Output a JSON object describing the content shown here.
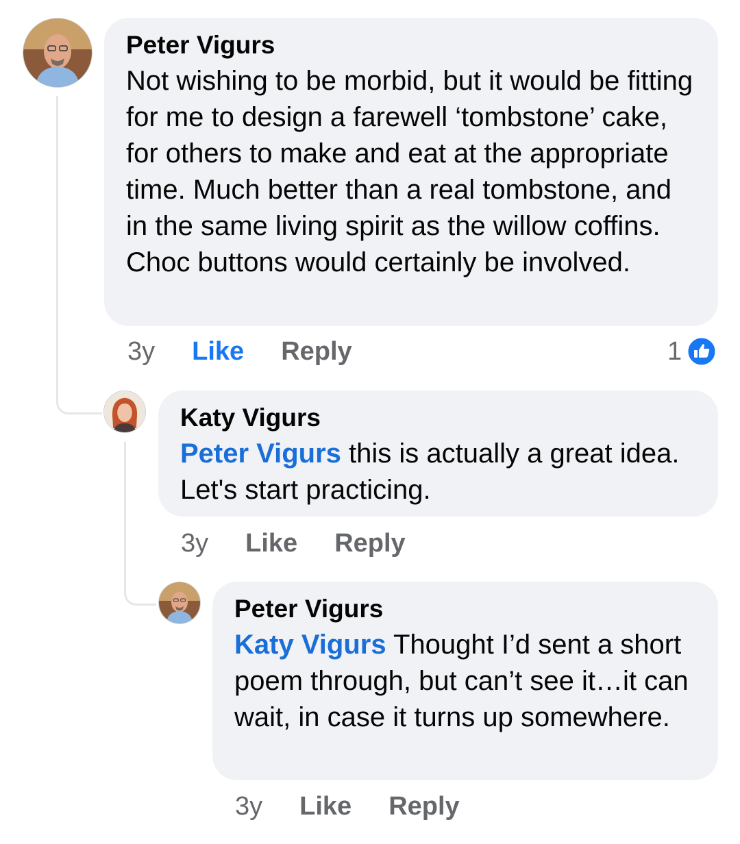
{
  "comments": [
    {
      "author": "Peter Vigurs",
      "text": "Not wishing to be morbid, but it would be fitting for me to design a farewell ‘tombstone’ cake, for others to make and eat at the appropriate time.  Much better than a real tombstone, and in the same living spirit as the willow coffins.  Choc buttons would certainly be involved.",
      "time": "3y",
      "like_label": "Like",
      "reply_label": "Reply",
      "reaction_count": "1",
      "liked": true
    },
    {
      "author": "Katy Vigurs",
      "mention": "Peter Vigurs",
      "text": " this is actually a great idea. Let's start practicing.",
      "time": "3y",
      "like_label": "Like",
      "reply_label": "Reply"
    },
    {
      "author": "Peter Vigurs",
      "mention": "Katy Vigurs",
      "text": "  Thought I’d sent a short poem through, but can’t see it…it can wait, in case it turns up somewhere.",
      "time": "3y",
      "like_label": "Like",
      "reply_label": "Reply"
    }
  ],
  "colors": {
    "bubble": "#f0f2f5",
    "mention": "#1a6ed8",
    "like_active": "#1877f2",
    "muted": "#65676b"
  }
}
